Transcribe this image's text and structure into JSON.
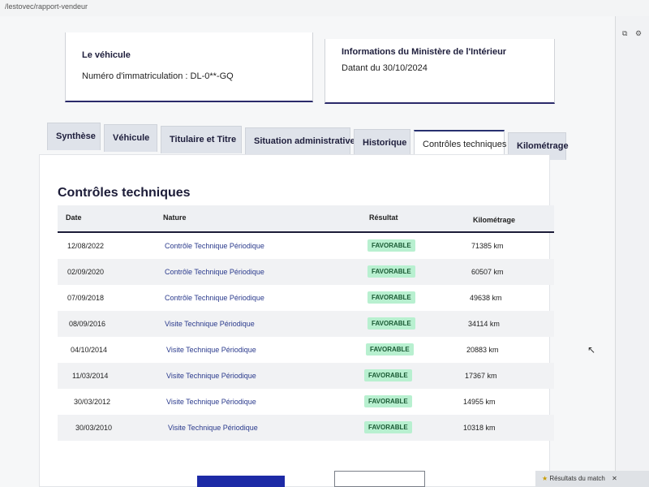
{
  "browser": {
    "url": "/lestovec/rapport-vendeur"
  },
  "vehicle_card": {
    "title": "Le véhicule",
    "line": "Numéro d'immatriculation : DL-0**-GQ"
  },
  "ministry_card": {
    "title": "Informations du Ministère de l'Intérieur",
    "line": "Datant du 30/10/2024"
  },
  "tabs": [
    {
      "label": "Synthèse"
    },
    {
      "label": "Véhicule"
    },
    {
      "label": "Titulaire et Titre"
    },
    {
      "label": "Situation administrative"
    },
    {
      "label": "Historique"
    },
    {
      "label": "Contrôles techniques"
    },
    {
      "label": "Kilométrage"
    }
  ],
  "section": {
    "title": "Contrôles techniques",
    "columns": [
      "Date",
      "Nature",
      "Résultat",
      "Kilométrage"
    ],
    "rows": [
      {
        "date": "12/08/2022",
        "nature": "Contrôle Technique Périodique",
        "result": "FAVORABLE",
        "km": "71385 km"
      },
      {
        "date": "02/09/2020",
        "nature": "Contrôle Technique Périodique",
        "result": "FAVORABLE",
        "km": "60507 km"
      },
      {
        "date": "07/09/2018",
        "nature": "Contrôle Technique Périodique",
        "result": "FAVORABLE",
        "km": "49638 km"
      },
      {
        "date": "08/09/2016",
        "nature": "Visite Technique Périodique",
        "result": "FAVORABLE",
        "km": "34114 km"
      },
      {
        "date": "04/10/2014",
        "nature": "Visite Technique Périodique",
        "result": "FAVORABLE",
        "km": "20883 km"
      },
      {
        "date": "11/03/2014",
        "nature": "Visite Technique Périodique",
        "result": "FAVORABLE",
        "km": "17367 km"
      },
      {
        "date": "30/03/2012",
        "nature": "Visite Technique Périodique",
        "result": "FAVORABLE",
        "km": "14955 km"
      },
      {
        "date": "30/03/2010",
        "nature": "Visite Technique Périodique",
        "result": "FAVORABLE",
        "km": "10318 km"
      }
    ]
  },
  "notification": {
    "text": "Résultats du match"
  },
  "icons": {
    "share": "share-icon",
    "settings": "settings-icon",
    "notify": "trophy-icon",
    "cursor": "mouse-cursor-icon"
  },
  "colors": {
    "accent": "#27306f",
    "badge_bg": "#b8f0d0",
    "badge_text": "#1a5a34",
    "primary_button": "#1d2aa6"
  }
}
